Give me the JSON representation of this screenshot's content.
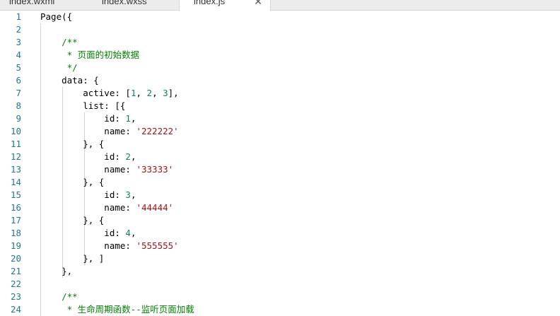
{
  "tabs": [
    {
      "label": "index.wxml",
      "active": false
    },
    {
      "label": "index.wxss",
      "active": false
    },
    {
      "label": "index.js",
      "active": true
    }
  ],
  "close_glyph": "✕",
  "colors": {
    "line_number": "#237893",
    "comment": "#008000",
    "number": "#098658",
    "string": "#a31515",
    "text": "#000000"
  },
  "code_lines": [
    [
      {
        "t": "Page({",
        "c": "plain"
      }
    ],
    [],
    [
      {
        "t": "    /**",
        "c": "comment"
      }
    ],
    [
      {
        "t": "     * 页面的初始数据",
        "c": "comment"
      }
    ],
    [
      {
        "t": "     */",
        "c": "comment"
      }
    ],
    [
      {
        "t": "    data: {",
        "c": "plain"
      }
    ],
    [
      {
        "t": "        active: [",
        "c": "plain"
      },
      {
        "t": "1",
        "c": "number"
      },
      {
        "t": ", ",
        "c": "plain"
      },
      {
        "t": "2",
        "c": "number"
      },
      {
        "t": ", ",
        "c": "plain"
      },
      {
        "t": "3",
        "c": "number"
      },
      {
        "t": "],",
        "c": "plain"
      }
    ],
    [
      {
        "t": "        list: [{",
        "c": "plain"
      }
    ],
    [
      {
        "t": "            id: ",
        "c": "plain"
      },
      {
        "t": "1",
        "c": "number"
      },
      {
        "t": ",",
        "c": "plain"
      }
    ],
    [
      {
        "t": "            name: ",
        "c": "plain"
      },
      {
        "t": "'222222'",
        "c": "string"
      }
    ],
    [
      {
        "t": "        }, {",
        "c": "plain"
      }
    ],
    [
      {
        "t": "            id: ",
        "c": "plain"
      },
      {
        "t": "2",
        "c": "number"
      },
      {
        "t": ",",
        "c": "plain"
      }
    ],
    [
      {
        "t": "            name: ",
        "c": "plain"
      },
      {
        "t": "'33333'",
        "c": "string"
      }
    ],
    [
      {
        "t": "        }, {",
        "c": "plain"
      }
    ],
    [
      {
        "t": "            id: ",
        "c": "plain"
      },
      {
        "t": "3",
        "c": "number"
      },
      {
        "t": ",",
        "c": "plain"
      }
    ],
    [
      {
        "t": "            name: ",
        "c": "plain"
      },
      {
        "t": "'44444'",
        "c": "string"
      }
    ],
    [
      {
        "t": "        }, {",
        "c": "plain"
      }
    ],
    [
      {
        "t": "            id: ",
        "c": "plain"
      },
      {
        "t": "4",
        "c": "number"
      },
      {
        "t": ",",
        "c": "plain"
      }
    ],
    [
      {
        "t": "            name: ",
        "c": "plain"
      },
      {
        "t": "'555555'",
        "c": "string"
      }
    ],
    [
      {
        "t": "        }, ]",
        "c": "plain"
      }
    ],
    [
      {
        "t": "    },",
        "c": "plain"
      }
    ],
    [],
    [
      {
        "t": "    /**",
        "c": "comment"
      }
    ],
    [
      {
        "t": "     * 生命周期函数--监听页面加载",
        "c": "comment"
      }
    ]
  ]
}
